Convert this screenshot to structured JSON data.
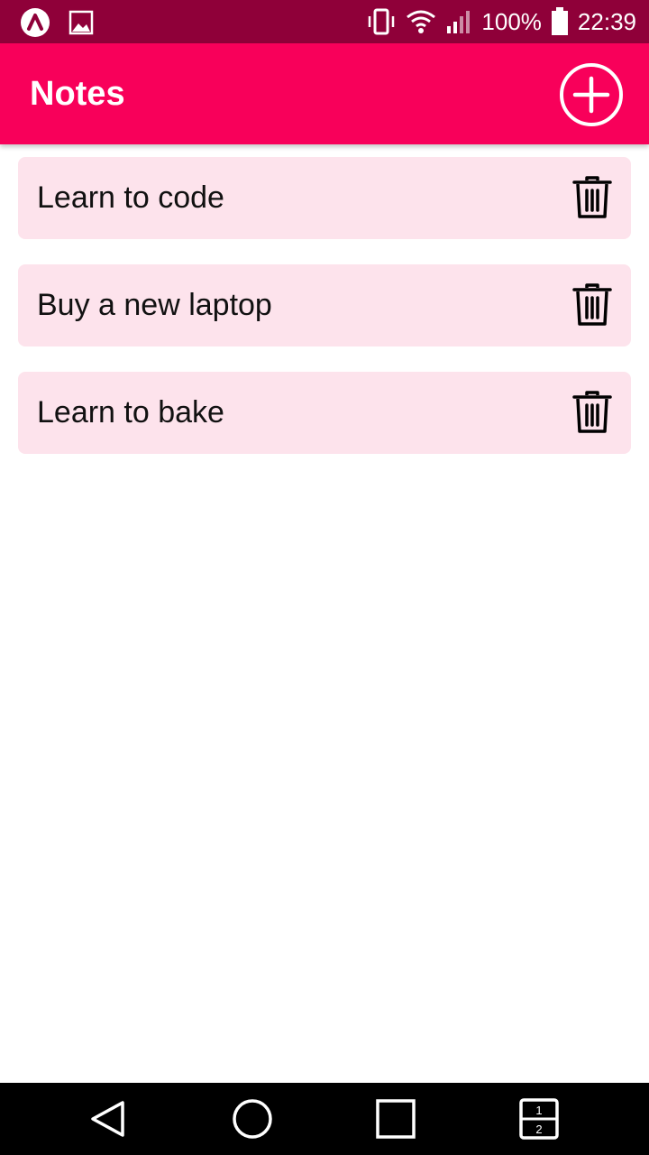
{
  "status_bar": {
    "battery_text": "100%",
    "time": "22:39",
    "icons": [
      "app-logo-icon",
      "image-icon",
      "vibrate-icon",
      "wifi-icon",
      "signal-icon",
      "battery-icon"
    ]
  },
  "app_bar": {
    "title": "Notes",
    "add_icon": "add-circle-icon"
  },
  "notes": [
    {
      "text": "Learn to code",
      "action_icon": "trash-icon"
    },
    {
      "text": "Buy a new laptop",
      "action_icon": "trash-icon"
    },
    {
      "text": "Learn to bake",
      "action_icon": "trash-icon"
    }
  ],
  "nav_bar": {
    "icons": [
      "back-icon",
      "home-icon",
      "recents-icon",
      "split-screen-icon"
    ],
    "split_labels": [
      "1",
      "2"
    ]
  },
  "colors": {
    "status_bar": "#8f0039",
    "app_bar": "#f8005a",
    "note_background": "#fde3ec",
    "nav_bar": "#000000"
  }
}
